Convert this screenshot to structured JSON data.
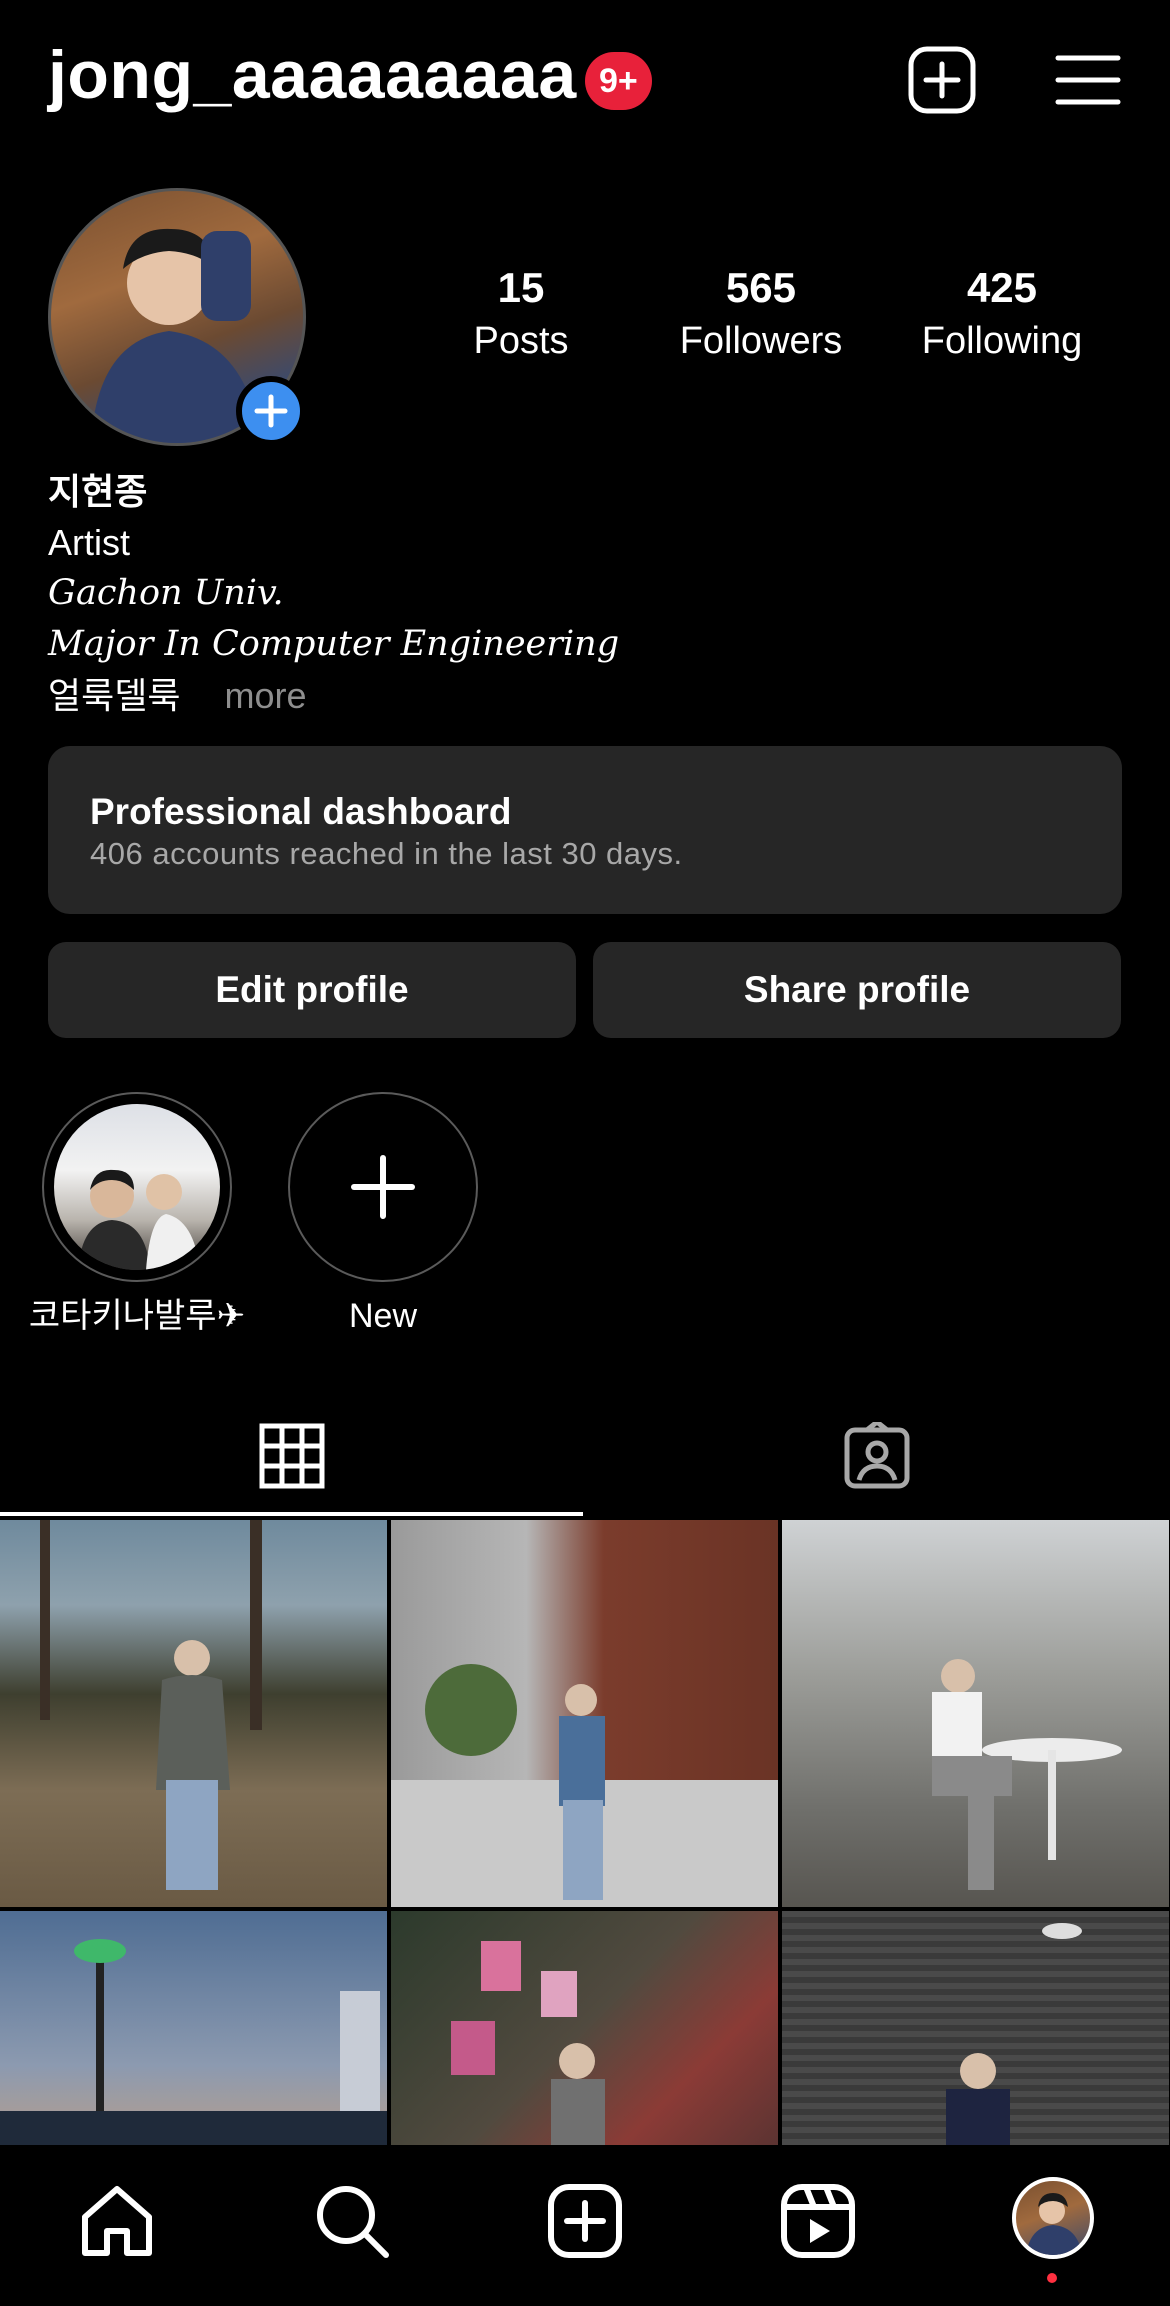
{
  "header": {
    "username": "jong_aaaaaaaaa",
    "notification_badge": "9+",
    "add_icon": "plus-square-icon",
    "menu_icon": "hamburger-menu-icon"
  },
  "profile": {
    "stats": [
      {
        "value": "15",
        "label": "Posts"
      },
      {
        "value": "565",
        "label": "Followers"
      },
      {
        "value": "425",
        "label": "Following"
      }
    ],
    "bio": {
      "name": "지현종",
      "category": "Artist",
      "line1": "Gachon Univ.",
      "line2": "Major In Computer Engineering",
      "line3": "얼룩델룩",
      "more": "more"
    }
  },
  "dashboard": {
    "title": "Professional dashboard",
    "subtitle": "406 accounts reached in the last 30 days."
  },
  "buttons": {
    "edit": "Edit profile",
    "share": "Share profile"
  },
  "highlights": [
    {
      "label": "코타키나발루✈"
    },
    {
      "label": "New"
    }
  ],
  "tabs": {
    "grid_icon": "grid-icon",
    "tagged_icon": "tagged-person-icon"
  },
  "bottom_nav": {
    "items": [
      "home-icon",
      "search-icon",
      "create-icon",
      "reels-icon",
      "profile-avatar"
    ]
  },
  "colors": {
    "background": "#000000",
    "surface": "#262626",
    "badge": "#e8213a",
    "accent_blue": "#3d8ff0",
    "muted_text": "#a8a8a8"
  }
}
